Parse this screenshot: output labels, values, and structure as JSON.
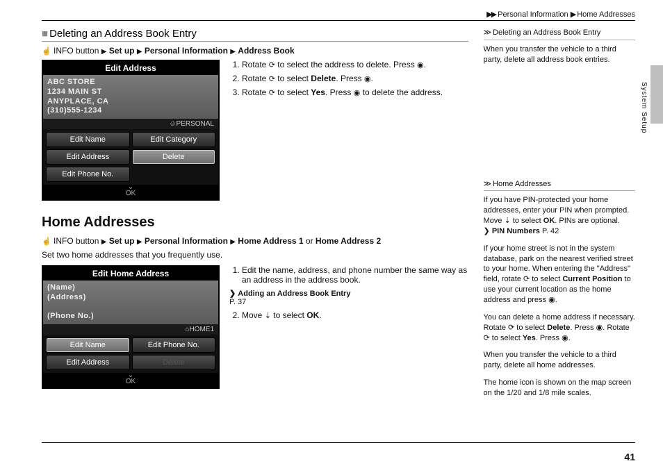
{
  "breadcrumb": {
    "a": "Personal Information",
    "b": "Home Addresses"
  },
  "sideLabel": "System Setup",
  "pageNumber": "41",
  "sec1": {
    "title": "Deleting an Address Book Entry",
    "navpath": {
      "pre": "INFO button",
      "items": [
        "Set up",
        "Personal Information",
        "Address Book"
      ]
    },
    "shot": {
      "title": "Edit Address",
      "lines": [
        "ABC STORE",
        "1234 MAIN ST",
        "ANYPLACE, CA",
        "(310)555-1234"
      ],
      "tag": "PERSONAL",
      "buttons": [
        "Edit Name",
        "Edit Category",
        "Edit Address",
        "Delete",
        "Edit Phone No."
      ],
      "ok": "OK"
    },
    "steps": [
      {
        "a": "Rotate ",
        "b": " to select the address to delete. Press ",
        "c": "."
      },
      {
        "a": "Rotate ",
        "b": " to select ",
        "bold": "Delete",
        "c": ". Press ",
        "d": "."
      },
      {
        "a": "Rotate ",
        "b": " to select ",
        "bold": "Yes",
        "c": ". Press ",
        "d": " to delete the address."
      }
    ]
  },
  "sec2": {
    "title": "Home Addresses",
    "navpath": {
      "pre": "INFO button",
      "items": [
        "Set up",
        "Personal Information",
        "Home Address 1"
      ],
      "tail": " or ",
      "tailBold": "Home Address 2"
    },
    "desc": "Set two home addresses that you frequently use.",
    "shot": {
      "title": "Edit Home Address",
      "lines": [
        "(Name)",
        "(Address)",
        "",
        "(Phone No.)"
      ],
      "tag": "HOME1",
      "buttons": [
        "Edit Name",
        "Edit Phone No.",
        "Edit Address",
        "Delete"
      ],
      "ok": "OK"
    },
    "steps": [
      "Edit the name, address, and phone number the same way as an address in the address book.",
      ""
    ],
    "xref": {
      "label": "Adding an Address Book Entry",
      "page": "P. 37"
    },
    "step2": {
      "a": "Move ",
      "b": " to select ",
      "bold": "OK",
      "c": "."
    }
  },
  "aside1": {
    "head": "Deleting an Address Book Entry",
    "p1": "When you transfer the vehicle to a third party, delete all address book entries."
  },
  "aside2": {
    "head": "Home Addresses",
    "p1a": "If you have PIN-protected your home addresses, enter your PIN when prompted. Move ",
    "p1b": " to select ",
    "p1bold": "OK",
    "p1c": ". PINs are optional.",
    "xref": {
      "label": "PIN Numbers",
      "page": "P. 42"
    },
    "p2a": "If your home street is not in the system database, park on the nearest verified street to your home. When entering the \"Address\" field, rotate ",
    "p2b": " to select ",
    "p2bold": "Current Position",
    "p2c": " to use your current location as the home address and press ",
    "p2d": ".",
    "p3a": "You can delete a home address if necessary. Rotate ",
    "p3b": " to select ",
    "p3bold1": "Delete",
    "p3c": ". Press ",
    "p3d": ". Rotate ",
    "p3e": " to select ",
    "p3bold2": "Yes",
    "p3f": ". Press ",
    "p3g": ".",
    "p4": "When you transfer the vehicle to a third party, delete all home addresses.",
    "p5": "The home icon is shown on the map screen on the 1/20 and 1/8 mile scales."
  },
  "glyphs": {
    "tri": "▶",
    "dblTri": "≫",
    "square": "■",
    "rotate": "⟳",
    "press": "◉",
    "move": "⇣",
    "hand": "☝",
    "book": "❯"
  }
}
